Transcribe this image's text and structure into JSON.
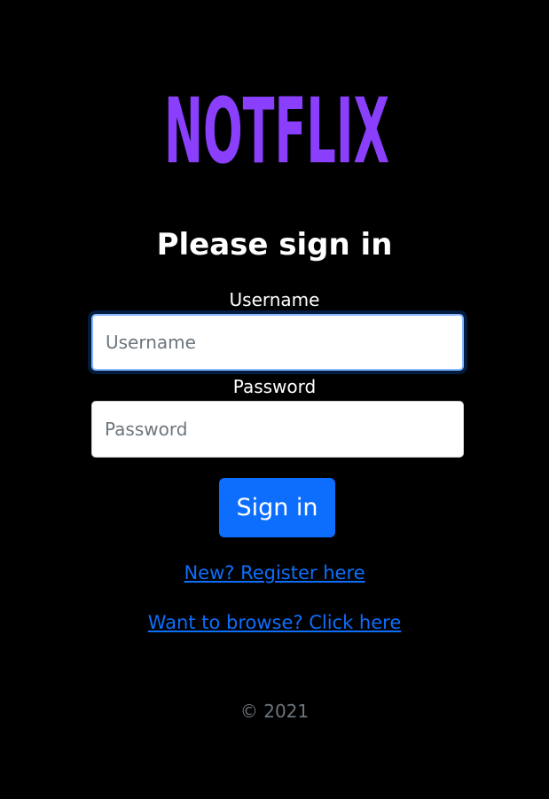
{
  "logo": {
    "text": "NOTFLIX",
    "color": "#8a3ffc"
  },
  "form": {
    "heading": "Please sign in",
    "username_label": "Username",
    "username_placeholder": "Username",
    "username_value": "",
    "password_label": "Password",
    "password_placeholder": "Password",
    "password_value": "",
    "submit_label": "Sign in"
  },
  "links": {
    "register": "New? Register here",
    "browse": "Want to browse? Click here"
  },
  "footer": {
    "copyright": "© 2021"
  },
  "colors": {
    "background": "#000000",
    "primary": "#0d6efd",
    "muted": "#6c757d"
  }
}
